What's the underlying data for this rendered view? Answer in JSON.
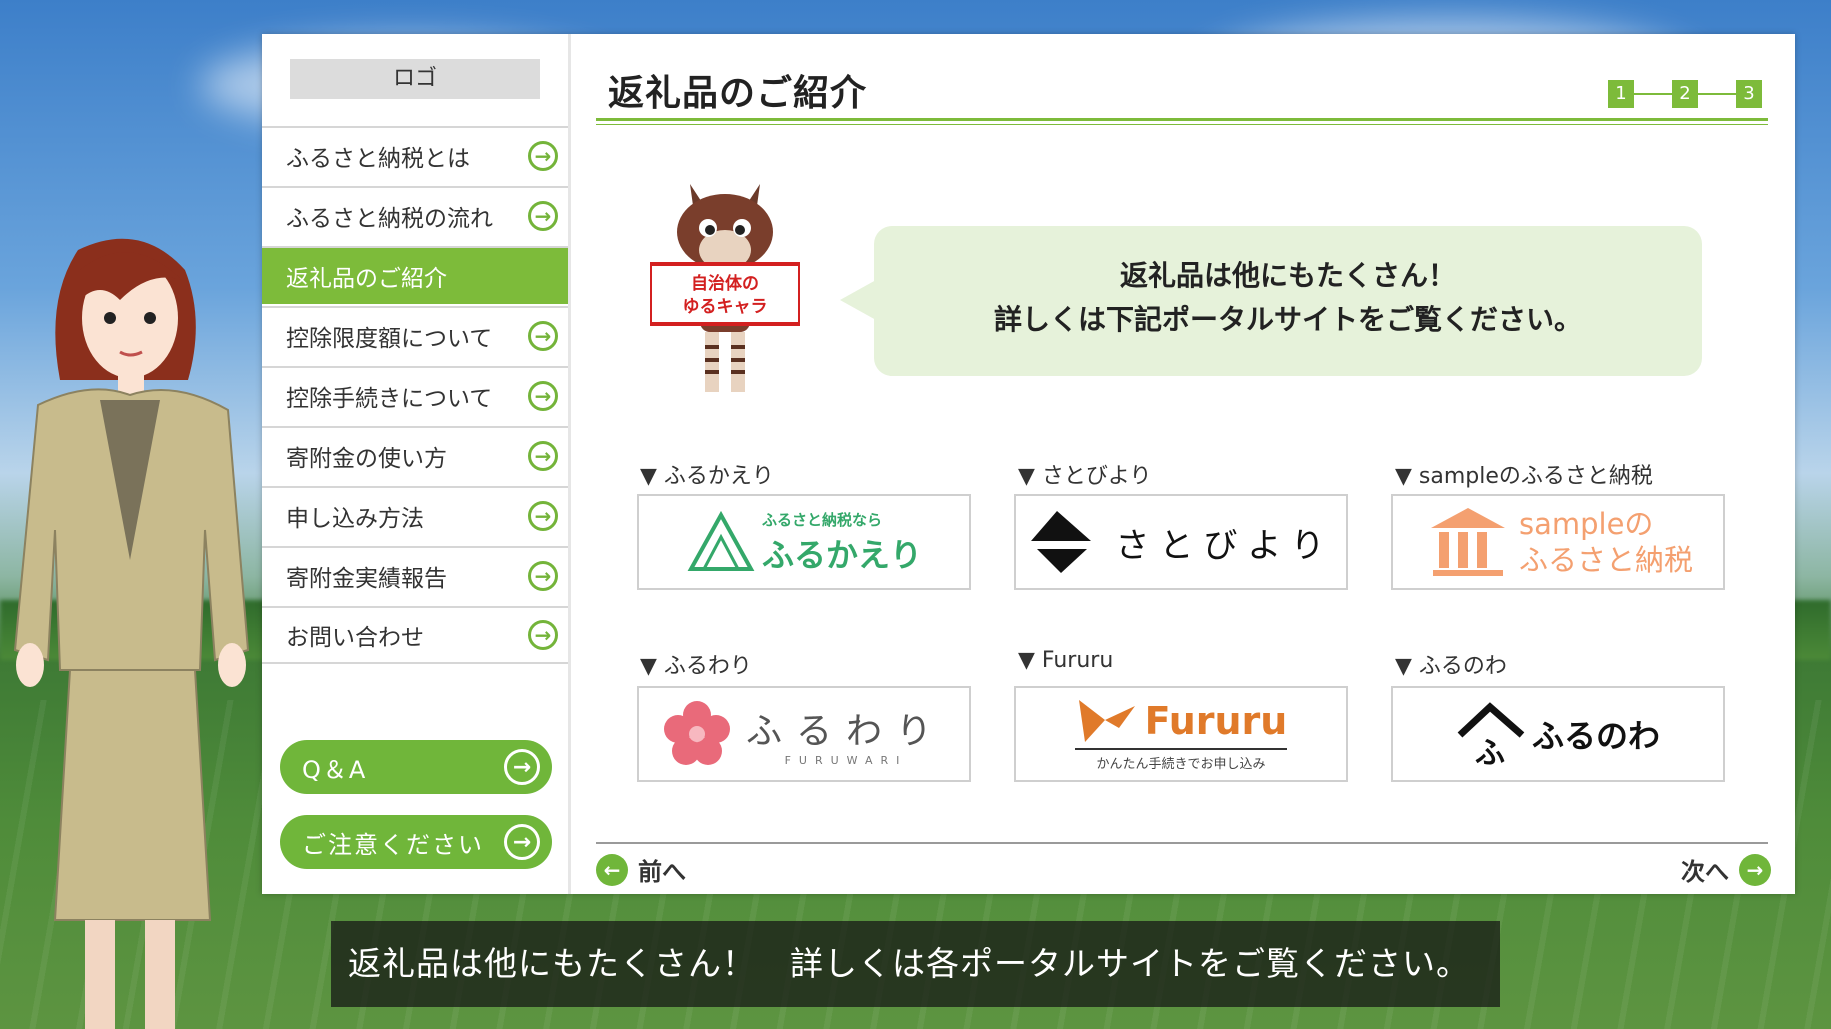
{
  "sidebar": {
    "logo": "ロゴ",
    "items": [
      {
        "label": "ふるさと納税とは"
      },
      {
        "label": "ふるさと納税の流れ"
      },
      {
        "label": "返礼品のご紹介"
      },
      {
        "label": "控除限度額について"
      },
      {
        "label": "控除手続きについて"
      },
      {
        "label": "寄附金の使い方"
      },
      {
        "label": "申し込み方法"
      },
      {
        "label": "寄附金実績報告"
      },
      {
        "label": "お問い合わせ"
      }
    ],
    "active_index": 2,
    "qa": "Q＆A",
    "notice": "ご注意ください"
  },
  "main": {
    "title": "返礼品のご紹介",
    "steps": [
      "1",
      "2",
      "3"
    ],
    "mascot_sign": [
      "自治体の",
      "ゆるキャラ"
    ],
    "bubble": [
      "返礼品は他にもたくさん！",
      "詳しくは下記ポータルサイトをご覧ください。"
    ],
    "portals": [
      {
        "label": "▼ ふるかえり",
        "logo_small": "ふるさと納税なら",
        "logo_main": "ふるかえり"
      },
      {
        "label": "▼ さとびより",
        "logo_main": "さとびより"
      },
      {
        "label": "▼ sampleのふるさと納税",
        "logo_top": "sampleの",
        "logo_bottom": "ふるさと納税"
      },
      {
        "label": "▼ ふるわり",
        "logo_main": "ふるわり",
        "logo_sub": "FURUWARI"
      },
      {
        "label": "▼ Fururu",
        "logo_main": "Fururu",
        "logo_sub": "かんたん手続きでお申し込み"
      },
      {
        "label": "▼ ふるのわ",
        "logo_main": "ふるのわ"
      }
    ],
    "prev": "前へ",
    "next": "次へ"
  },
  "subtitle": "返礼品は他にもたくさん！　詳しくは各ポータルサイトをご覧ください。",
  "colors": {
    "accent": "#7dbb3a",
    "bubble": "#e6f2da",
    "sample_orange": "#f4a070",
    "furuwari_pink": "#e96a7a",
    "fururu_orange": "#e07a2a"
  }
}
